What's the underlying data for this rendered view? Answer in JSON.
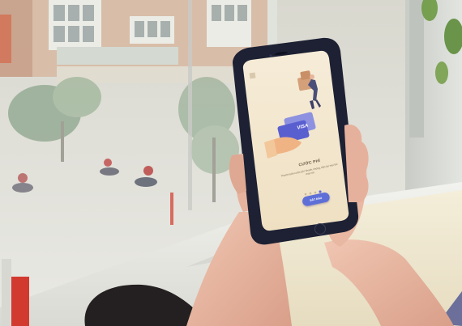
{
  "phone_screen": {
    "card_brand": "VISA",
    "title": "CƯỚC PHÍ",
    "description": "Thanh toán cước phí nhanh chóng, tiện lợi mọi lúc mọi nơi",
    "button_label": "BẮT ĐẦU",
    "page_indicator": {
      "total": 4,
      "active": 3
    }
  },
  "colors": {
    "screen_background": "#f2e6cf",
    "card_primary": "#5a5fd0",
    "card_secondary": "#8d91e0",
    "button": "#5f6fd8",
    "phone_body": "#1d2133",
    "skin": "#e9b8a3",
    "cushion": "#efe8cf"
  }
}
